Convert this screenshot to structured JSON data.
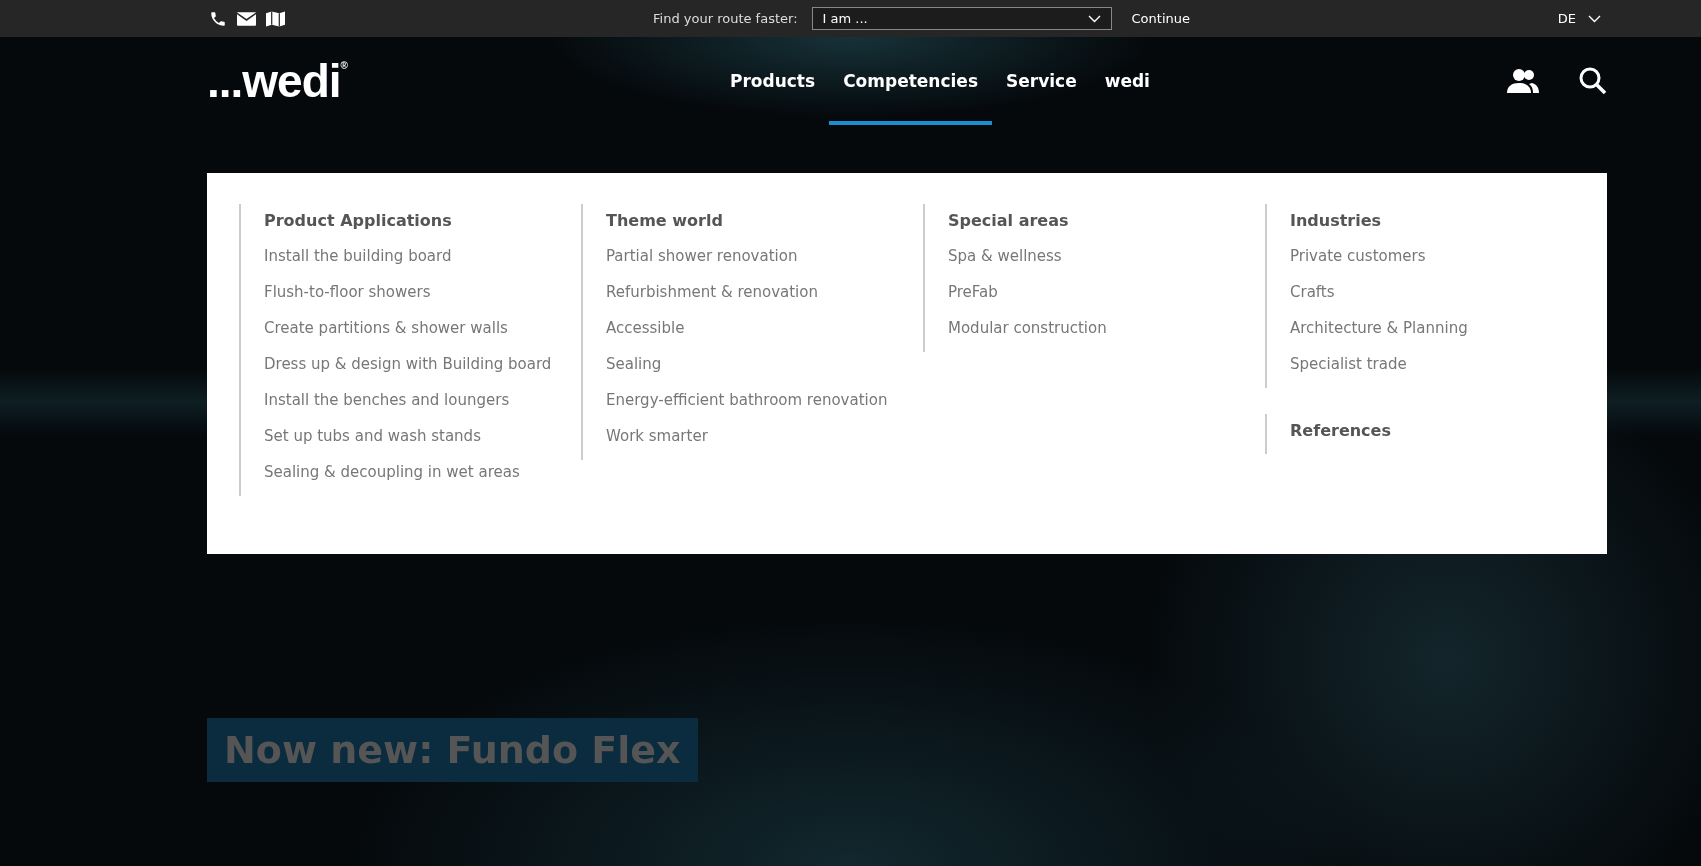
{
  "topbar": {
    "route_label": "Find your route faster:",
    "route_select": {
      "value": "I am ..."
    },
    "continue": "Continue",
    "language": "DE"
  },
  "logo": {
    "text": "...wedi",
    "mark": "®"
  },
  "nav": [
    {
      "label": "Products",
      "selected": false
    },
    {
      "label": "Competencies",
      "selected": true
    },
    {
      "label": "Service",
      "selected": false
    },
    {
      "label": "wedi",
      "selected": false
    }
  ],
  "menu": {
    "columns": [
      {
        "groups": [
          {
            "title": "Product Applications",
            "items": [
              "Install the building board",
              "Flush-to-floor showers",
              "Create partitions & shower walls",
              "Dress up & design with Building board",
              "Install the benches and loungers",
              "Set up tubs and wash stands",
              "Sealing & decoupling in wet areas"
            ]
          }
        ]
      },
      {
        "groups": [
          {
            "title": "Theme world",
            "items": [
              "Partial shower renovation",
              "Refurbishment & renovation",
              "Accessible",
              "Sealing",
              "Energy-efficient bathroom renovation",
              "Work smarter"
            ]
          }
        ]
      },
      {
        "groups": [
          {
            "title": "Special areas",
            "items": [
              "Spa & wellness",
              "PreFab",
              "Modular construction"
            ]
          }
        ]
      },
      {
        "groups": [
          {
            "title": "Industries",
            "items": [
              "Private customers",
              "Crafts",
              "Architecture & Planning",
              "Specialist trade"
            ]
          },
          {
            "title": "References"
          }
        ]
      }
    ]
  },
  "hero": {
    "headline": "Now new: Fundo Flex"
  }
}
